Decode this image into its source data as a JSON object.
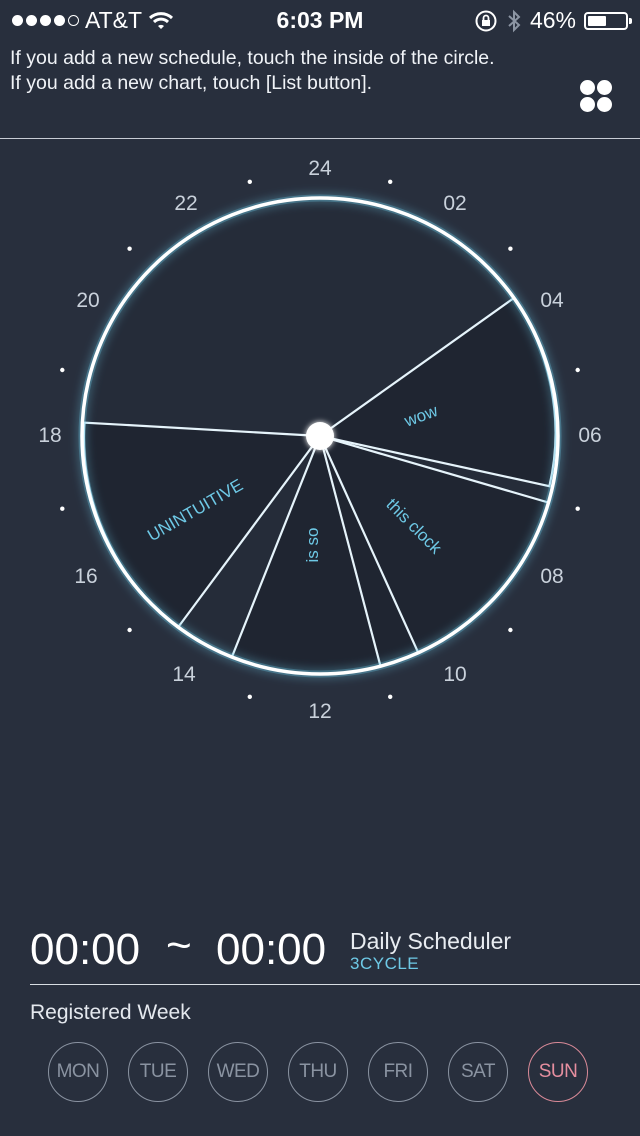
{
  "status_bar": {
    "carrier": "AT&T",
    "time": "6:03 PM",
    "battery": "46%",
    "signal_icon": "signal-dots-icon",
    "wifi_icon": "wifi-icon",
    "rotation_lock_icon": "rotation-lock-icon",
    "bluetooth_icon": "bluetooth-icon"
  },
  "hint": {
    "line1": "If you add a new schedule, touch the inside of the circle.",
    "line2": "If you add a new chart, touch [List button]."
  },
  "list_button_icon": "grid-list-icon",
  "clock": {
    "hour_labels": [
      "24",
      "02",
      "04",
      "06",
      "08",
      "10",
      "12",
      "14",
      "16",
      "18",
      "20",
      "22"
    ],
    "sector_labels": {
      "wow": "wow",
      "this_clock": "this clock",
      "is_so": "is so",
      "unintuitive": "UNINTUITIVE"
    },
    "accent_color": "#6ec9e6"
  },
  "time_range": {
    "start": "00:00",
    "separator": "~",
    "end": "00:00"
  },
  "app": {
    "name": "Daily Scheduler",
    "subtitle": "3CYCLE"
  },
  "week": {
    "label": "Registered Week",
    "days": [
      "MON",
      "TUE",
      "WED",
      "THU",
      "FRI",
      "SAT",
      "SUN"
    ],
    "selected": "SUN",
    "selected_color": "#e58e9f"
  }
}
